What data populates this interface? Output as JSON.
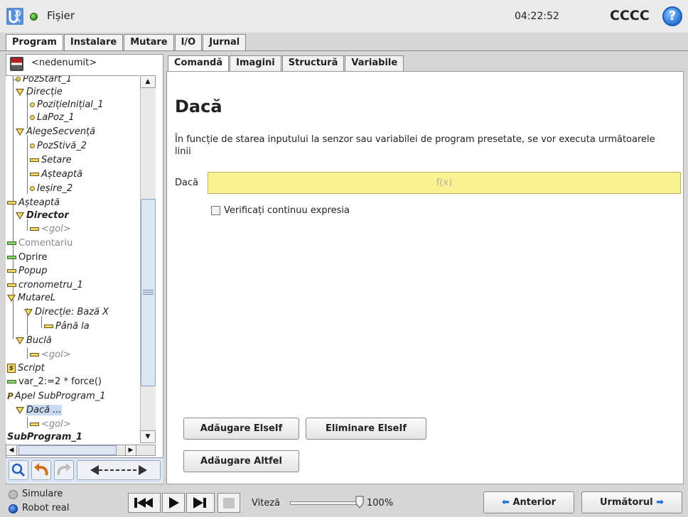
{
  "header": {
    "file_label": "Fișier",
    "clock": "04:22:52",
    "robot_name": "CCCC",
    "help": "?"
  },
  "main_tabs": [
    {
      "label": "Program",
      "active": true
    },
    {
      "label": "Instalare",
      "active": false
    },
    {
      "label": "Mutare",
      "active": false
    },
    {
      "label": "I/O",
      "active": false
    },
    {
      "label": "Jurnal",
      "active": false
    }
  ],
  "program": {
    "name": "<nedenumit>",
    "tree": [
      {
        "label": "PozStart_1",
        "icon": "waypoint-icon",
        "style": "italic"
      },
      {
        "label": "Direcție",
        "icon": "folder-triangle-icon",
        "style": "italic"
      },
      {
        "label": "PozițieInițial_1",
        "icon": "waypoint-icon",
        "style": "italic"
      },
      {
        "label": "LaPoz_1",
        "icon": "waypoint-icon",
        "style": "italic"
      },
      {
        "label": "AlegeSecvență",
        "icon": "folder-triangle-icon",
        "style": "italic"
      },
      {
        "label": "PozStivă_2",
        "icon": "waypoint-icon",
        "style": "italic"
      },
      {
        "label": "Setare",
        "icon": "command-bar-icon",
        "style": "italic"
      },
      {
        "label": "Așteaptă",
        "icon": "command-bar-icon",
        "style": "italic"
      },
      {
        "label": "Ieșire_2",
        "icon": "waypoint-icon",
        "style": "italic"
      },
      {
        "label": "Așteaptă",
        "icon": "command-bar-icon",
        "style": "italic"
      },
      {
        "label": "Director",
        "icon": "folder-triangle-icon",
        "style": "bold-italic"
      },
      {
        "label": "<gol>",
        "icon": "command-bar-icon",
        "style": "grey-italic"
      },
      {
        "label": "Comentariu",
        "icon": "green-bar-icon",
        "style": "grey"
      },
      {
        "label": "Oprire",
        "icon": "green-bar-icon",
        "style": "normal"
      },
      {
        "label": "Popup",
        "icon": "command-bar-icon",
        "style": "italic"
      },
      {
        "label": "cronometru_1",
        "icon": "command-bar-icon",
        "style": "italic"
      },
      {
        "label": "MutareL",
        "icon": "folder-triangle-icon",
        "style": "italic"
      },
      {
        "label": "Direcție: Bază X",
        "icon": "folder-triangle-icon",
        "style": "italic"
      },
      {
        "label": "Până la",
        "icon": "command-bar-icon",
        "style": "italic"
      },
      {
        "label": "Buclă",
        "icon": "folder-triangle-icon",
        "style": "italic"
      },
      {
        "label": "<gol>",
        "icon": "command-bar-icon",
        "style": "grey-italic"
      },
      {
        "label": "Script",
        "icon": "script-icon",
        "style": "italic"
      },
      {
        "label": "var_2:=2 * force()",
        "icon": "green-bar-icon",
        "style": "normal"
      },
      {
        "label": "Apel SubProgram_1",
        "icon": "call-p-icon",
        "style": "italic"
      },
      {
        "label": "Dacă ...",
        "icon": "folder-triangle-icon",
        "style": "italic-selected"
      },
      {
        "label": "<gol>",
        "icon": "command-bar-icon",
        "style": "grey-italic"
      },
      {
        "label": "SubProgram_1",
        "icon": "none",
        "style": "bold-italic"
      }
    ]
  },
  "right_tabs": [
    {
      "label": "Comandă",
      "active": true
    },
    {
      "label": "Imagini",
      "active": false
    },
    {
      "label": "Structură",
      "active": false
    },
    {
      "label": "Variabile",
      "active": false
    }
  ],
  "command": {
    "title": "Dacă",
    "description": "În funcție de starea inputului la senzor sau variabilei de program presetate, se vor executa următoarele linii",
    "if_label": "Dacă",
    "expression_placeholder": "f(x)",
    "checkbox_label": "Verificați continuu expresia",
    "checkbox_checked": false,
    "add_elseif": "Adăugare ElseIf",
    "remove_elseif": "Eliminare ElseIf",
    "add_else": "Adăugare Altfel"
  },
  "footer": {
    "simulation": "Simulare",
    "real_robot": "Robot real",
    "real_robot_selected": true,
    "speed_label": "Viteză",
    "speed_value": "100%",
    "speed_fraction": 1.0,
    "previous": "Anterior",
    "next": "Următorul"
  },
  "colors": {
    "expression_field": "#f8f290",
    "selection": "#c7daf2",
    "active_dot": "#2f8a1b"
  }
}
